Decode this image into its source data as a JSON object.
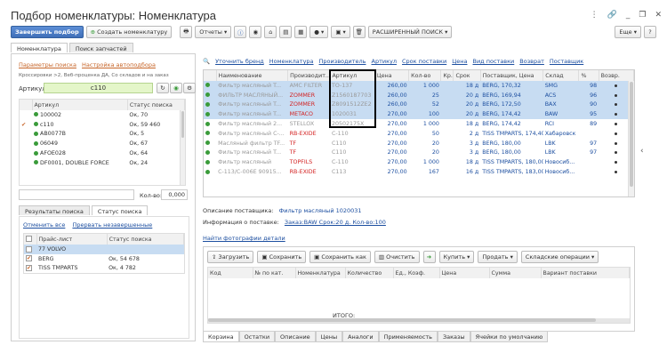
{
  "window": {
    "title": "Подбор номенклатуры: Номенклатура"
  },
  "toolbar": {
    "finish": "Завершить подбор",
    "create": "Создать номенклатуру",
    "reports": "Отчеты",
    "adv_search": "РАСШИРЕННЫЙ ПОИСК",
    "more": "Еще",
    "help": "?"
  },
  "left_tabs": [
    "Номенклатура",
    "Поиск запчастей"
  ],
  "search_params": {
    "params_link": "Параметры поиска",
    "setup_link": "Настройка автоподбора",
    "hint": "Кроссировки >2, Веб-проценка ДА, Со складов и на заказ",
    "article_label": "Артикул:",
    "article_value": "с110"
  },
  "article_table": {
    "headers": [
      "Артикул",
      "Статус поиска"
    ],
    "rows": [
      [
        "100002",
        "Ок, 70"
      ],
      [
        "с110",
        "Ок, 59 460"
      ],
      [
        "AB0077B",
        "Ок, 5"
      ],
      [
        "06049",
        "Ок, 67"
      ],
      [
        "AFOE028",
        "Ок, 64"
      ],
      [
        "DF0001, DOUBLE FORCE",
        "Ок, 24"
      ]
    ],
    "qty_label": "Кол-во:",
    "qty_value": "0,000"
  },
  "result_tabs": [
    "Результаты поиска",
    "Статус поиска"
  ],
  "status_links": {
    "cancel": "Отменить все",
    "abort": "Прервать незавершенные"
  },
  "price_table": {
    "headers": [
      "Прайс-лист",
      "Статус поиска"
    ],
    "rows": [
      [
        "77 VOLVO",
        ""
      ],
      [
        "BERG",
        "Ок, 54 678"
      ],
      [
        "TISS TMPARTS",
        "Ок, 4 782"
      ]
    ]
  },
  "top_links": [
    "Уточнить бренд",
    "Номенклатура",
    "Производитель",
    "Артикул",
    "Срок поставки",
    "Цена",
    "Вид поставки",
    "Возврат",
    "Поставщик"
  ],
  "main_table": {
    "headers": [
      "Наименование",
      "Производит...",
      "Артикул",
      "Цена",
      "Кол-во",
      "Кр.",
      "Срок",
      "Поставщик, Цена",
      "Склад",
      "%",
      "Возвр."
    ],
    "rows": [
      [
        "Фильтр масляный T...",
        "AMC FILTER",
        "TO-137",
        "260,00",
        "1 000",
        "",
        "18 д",
        "BERG, 170,32",
        "SMG",
        "98"
      ],
      [
        "ФИЛЬТР МАСЛЯНЫЙ...",
        "ZOMMER",
        "Z1560187703",
        "260,00",
        "25",
        "",
        "20 д",
        "BERG, 169,94",
        "ACS",
        "96"
      ],
      [
        "Фильтр масляный T...",
        "ZOMMER",
        "Z8091512ZE2",
        "260,00",
        "52",
        "",
        "20 д",
        "BERG, 172,50",
        "BAX",
        "90"
      ],
      [
        "Фильтр масляный T...",
        "METACO",
        "1020031",
        "270,00",
        "100",
        "",
        "20 д",
        "BERG, 174,42",
        "BAW",
        "95"
      ],
      [
        "Фильтр масляный  2...",
        "STELLOX",
        "20502175X",
        "270,00",
        "1 000",
        "",
        "18 д",
        "BERG, 174,42",
        "RCI",
        "89"
      ],
      [
        "Фильтр масляный C-...",
        "RB-EXIDE",
        "C-110",
        "270,00",
        "50",
        "",
        "2 д",
        "TISS TMPARTS, 174,40",
        "Хабаровск",
        ""
      ],
      [
        "Масляный фильтр TF...",
        "TF",
        "C110",
        "270,00",
        "20",
        "",
        "3 д",
        "BERG, 180,00",
        "LBK",
        "97"
      ],
      [
        "Фильтр масляный  T...",
        "TF",
        "C110",
        "270,00",
        "20",
        "",
        "3 д",
        "BERG, 180,00",
        "LBK",
        "97"
      ],
      [
        "Фильтр масляный",
        "TOPFILS",
        "C-110",
        "270,00",
        "1 000",
        "",
        "18 д",
        "TISS TMPARTS, 180,00",
        "Новосиб...",
        ""
      ],
      [
        "C-113/C-006E  90915...",
        "RB-EXIDE",
        "C113",
        "270,00",
        "167",
        "",
        "16 д",
        "TISS TMPARTS, 183,00",
        "Новосиб...",
        ""
      ]
    ]
  },
  "info": {
    "desc_label": "Описание поставщика:",
    "desc_value": "Фильтр масляный 1020031",
    "info_label": "Информация о поставке:",
    "info_value": "Заказ:BAW Срок:20 д. Кол-во:100",
    "photos": "Найти фотографии детали"
  },
  "cart_toolbar": {
    "load": "Загрузить",
    "save": "Сохранить",
    "save_as": "Сохранить как",
    "clear": "Очистить",
    "buy": "Купить",
    "sell": "Продать",
    "ops": "Складские операции"
  },
  "cart_table": {
    "headers": [
      "Код",
      "№ по кат.",
      "Номенклатура",
      "Количество",
      "Ед., Коэф.",
      "Цена",
      "Сумма",
      "Вариант поставки"
    ],
    "total": "ИТОГО:"
  },
  "bottom_tabs": [
    "Корзина",
    "Остатки",
    "Описание",
    "Цены",
    "Аналоги",
    "Применяемость",
    "Заказы",
    "Ячейки по умолчанию"
  ]
}
